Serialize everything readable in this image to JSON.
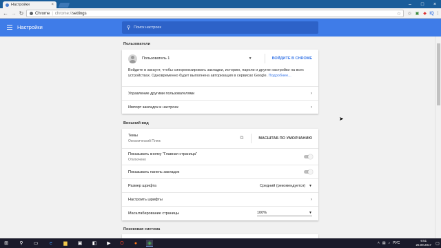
{
  "browser": {
    "tab_title": "Настройки",
    "omnibox_site": "Chrome",
    "omnibox_scheme": "chrome://",
    "omnibox_path": "settings",
    "ext_badge": "IQ"
  },
  "header": {
    "title": "Настройки",
    "search_placeholder": "Поиск настроек"
  },
  "people": {
    "section_title": "Пользователи",
    "user_name": "Пользователь 1",
    "sign_in_label": "ВОЙДИТЕ В CHROME",
    "description": "Войдите в аккаунт, чтобы синхронизировать закладки, историю, пароли и другие настройки на всех устройствах. Одновременно будет выполнена авторизация в сервисах Google.",
    "learn_more": "Подробнее...",
    "manage_users": "Управление другими пользователями",
    "import": "Импорт закладок и настроек"
  },
  "appearance": {
    "section_title": "Внешний вид",
    "themes_label": "Темы",
    "themes_value": "Океанический Пляж",
    "reset_theme": "МАСШТАБ ПО УМОЛЧАНИЮ",
    "home_button_label": "Показывать кнопку \"Главная страница\"",
    "home_button_value": "Отключено",
    "bookmarks_bar_label": "Показывать панель закладок",
    "font_size_label": "Размер шрифта",
    "font_size_value": "Средний (рекомендуется)",
    "customize_fonts": "Настроить шрифты",
    "page_zoom_label": "Масштабирование страницы",
    "page_zoom_value": "100%"
  },
  "search_engine": {
    "section_title": "Поисковая система"
  },
  "taskbar": {
    "lang": "РУС",
    "time": "9:51",
    "date": "25.09.2017"
  }
}
